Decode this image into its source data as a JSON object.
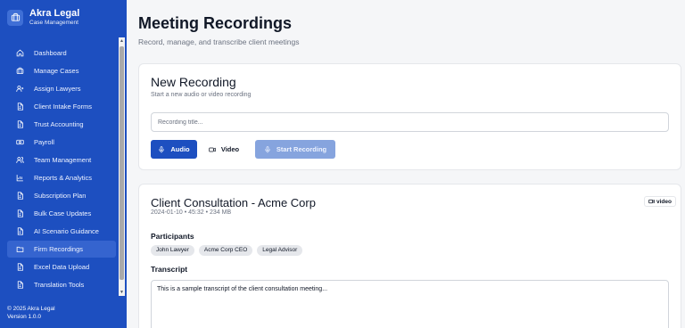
{
  "brand": {
    "name": "Akra Legal",
    "subtitle": "Case Management"
  },
  "sidebar": {
    "items": [
      {
        "label": "Dashboard",
        "icon": "home-icon",
        "active": false
      },
      {
        "label": "Manage Cases",
        "icon": "briefcase-icon",
        "active": false
      },
      {
        "label": "Assign Lawyers",
        "icon": "user-plus-icon",
        "active": false
      },
      {
        "label": "Client Intake Forms",
        "icon": "file-icon",
        "active": false
      },
      {
        "label": "Trust Accounting",
        "icon": "file-icon",
        "active": false
      },
      {
        "label": "Payroll",
        "icon": "banknote-icon",
        "active": false
      },
      {
        "label": "Team Management",
        "icon": "users-icon",
        "active": false
      },
      {
        "label": "Reports & Analytics",
        "icon": "bar-chart-icon",
        "active": false
      },
      {
        "label": "Subscription Plan",
        "icon": "file-icon",
        "active": false
      },
      {
        "label": "Bulk Case Updates",
        "icon": "file-icon",
        "active": false
      },
      {
        "label": "AI Scenario Guidance",
        "icon": "file-icon",
        "active": false
      },
      {
        "label": "Firm Recordings",
        "icon": "folder-icon",
        "active": true
      },
      {
        "label": "Excel Data Upload",
        "icon": "file-icon",
        "active": false
      },
      {
        "label": "Translation Tools",
        "icon": "file-icon",
        "active": false
      }
    ]
  },
  "footer": {
    "copyright": "© 2025 Akra Legal",
    "version": "Version 1.0.0"
  },
  "page": {
    "title": "Meeting Recordings",
    "subtitle": "Record, manage, and transcribe client meetings"
  },
  "new_recording": {
    "title": "New Recording",
    "subtitle": "Start a new audio or video recording",
    "input_placeholder": "Recording title...",
    "input_value": "",
    "audio_label": "Audio",
    "video_label": "Video",
    "start_label": "Start Recording",
    "selected_mode": "Audio"
  },
  "recording": {
    "title": "Client Consultation - Acme Corp",
    "meta": "2024-01-10 • 45:32 • 234 MB",
    "type_badge": "video",
    "participants_label": "Participants",
    "participants": [
      "John Lawyer",
      "Acme Corp CEO",
      "Legal Advisor"
    ],
    "transcript_label": "Transcript",
    "transcript": "This is a sample transcript of the client consultation meeting..."
  },
  "colors": {
    "sidebar_bg": "#1d4fc0",
    "accent": "#1d4fc0",
    "active_item": "#3564cf",
    "disabled_button": "#86a4de"
  }
}
